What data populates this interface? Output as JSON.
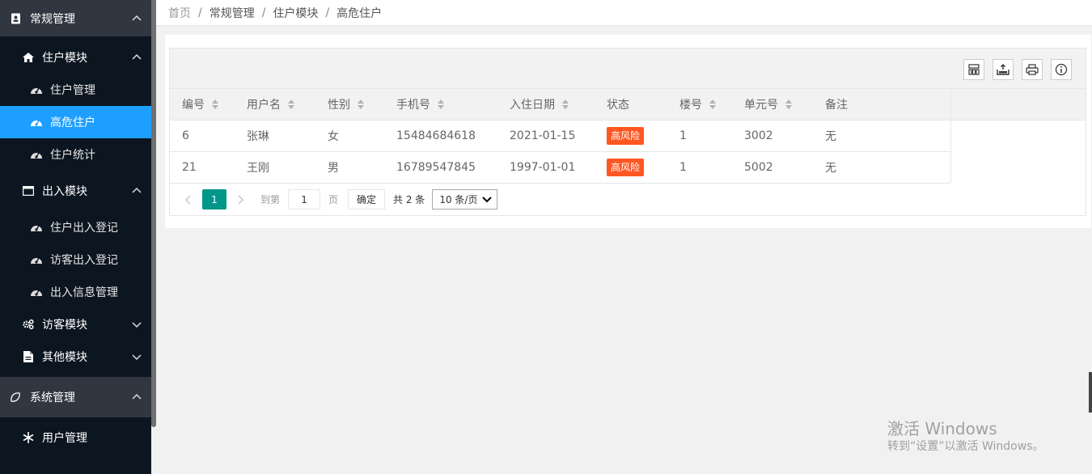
{
  "sidebar": {
    "group1": {
      "label": "常规管理",
      "icon": "address-book-icon"
    },
    "module_resident": {
      "label": "住户模块",
      "icon": "home-icon"
    },
    "resident_items": [
      {
        "label": "住户管理",
        "icon": "dashboard-icon",
        "active": false
      },
      {
        "label": "高危住户",
        "icon": "dashboard-icon",
        "active": true
      },
      {
        "label": "住户统计",
        "icon": "dashboard-icon",
        "active": false
      }
    ],
    "module_access": {
      "label": "出入模块",
      "icon": "window-icon"
    },
    "access_items": [
      {
        "label": "住户出入登记",
        "icon": "dashboard-icon"
      },
      {
        "label": "访客出入登记",
        "icon": "dashboard-icon"
      },
      {
        "label": "出入信息管理",
        "icon": "dashboard-icon"
      }
    ],
    "module_visitor": {
      "label": "访客模块",
      "icon": "gears-icon"
    },
    "module_other": {
      "label": "其他模块",
      "icon": "file-icon"
    },
    "group2": {
      "label": "系统管理",
      "icon": "leaf-icon"
    },
    "system_items": [
      {
        "label": "用户管理",
        "icon": "snowflake-icon"
      }
    ]
  },
  "breadcrumb": [
    "首页",
    "常规管理",
    "住户模块",
    "高危住户"
  ],
  "table": {
    "columns": [
      "编号",
      "用户名",
      "性别",
      "手机号",
      "入住日期",
      "状态",
      "楼号",
      "单元号",
      "备注"
    ],
    "rows": [
      {
        "id": "6",
        "username": "张琳",
        "gender": "女",
        "phone": "15484684618",
        "date": "2021-01-15",
        "status": "高风险",
        "building": "1",
        "unit": "3002",
        "note": "无"
      },
      {
        "id": "21",
        "username": "王刚",
        "gender": "男",
        "phone": "16789547845",
        "date": "1997-01-01",
        "status": "高风险",
        "building": "1",
        "unit": "5002",
        "note": "无"
      }
    ],
    "toolbar_icons": [
      "columns-filter-icon",
      "export-icon",
      "print-icon",
      "info-icon"
    ]
  },
  "pagination": {
    "current": "1",
    "goto_label": "到第",
    "goto_value": "1",
    "page_label": "页",
    "confirm": "确定",
    "total": "共 2 条",
    "page_size": "10 条/页"
  },
  "watermark": {
    "line1": "激活 Windows",
    "line2": "转到“设置”以激活 Windows。"
  },
  "colors": {
    "sidebar_bg": "#0c1621",
    "active": "#1e9fff",
    "badge": "#ff5722",
    "page_current": "#009688"
  }
}
